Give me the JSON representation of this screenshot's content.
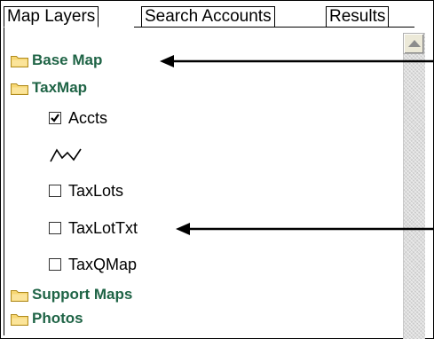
{
  "tabs": [
    {
      "label": "Map Layers",
      "active": true
    },
    {
      "label": "Search Accounts",
      "active": false
    },
    {
      "label": "Results",
      "active": false
    }
  ],
  "tree": {
    "folders": {
      "base_map": "Base Map",
      "taxmap": "TaxMap",
      "support_maps": "Support Maps",
      "photos": "Photos"
    },
    "layers": {
      "accts": {
        "label": "Accts",
        "checked": true
      },
      "taxlots": {
        "label": "TaxLots",
        "checked": false
      },
      "taxlottxt": {
        "label": "TaxLotTxt",
        "checked": false
      },
      "taxqmap": {
        "label": "TaxQMap",
        "checked": false
      }
    },
    "line_symbol": "line-symbol-icon"
  },
  "colors": {
    "folder_label": "#1f6446",
    "folder_fill": "#f7d774",
    "scrollbar": "#dcdcdc"
  }
}
